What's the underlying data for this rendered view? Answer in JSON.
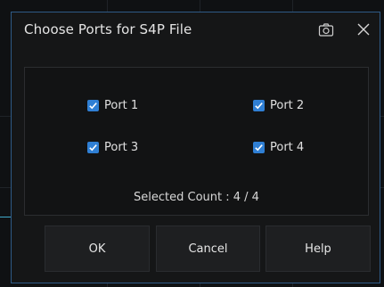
{
  "dialog": {
    "title": "Choose Ports for S4P File",
    "camera_icon": "camera-icon",
    "close_icon": "close-icon"
  },
  "ports": [
    {
      "label": "Port 1",
      "checked": true
    },
    {
      "label": "Port 2",
      "checked": true
    },
    {
      "label": "Port 3",
      "checked": true
    },
    {
      "label": "Port 4",
      "checked": true
    }
  ],
  "selected_count_text": "Selected Count : 4 / 4",
  "buttons": {
    "ok": "OK",
    "cancel": "Cancel",
    "help": "Help"
  },
  "colors": {
    "accent": "#2f7fd4",
    "dialog_border": "#2e5a86",
    "trace": "#3fa9c9"
  }
}
